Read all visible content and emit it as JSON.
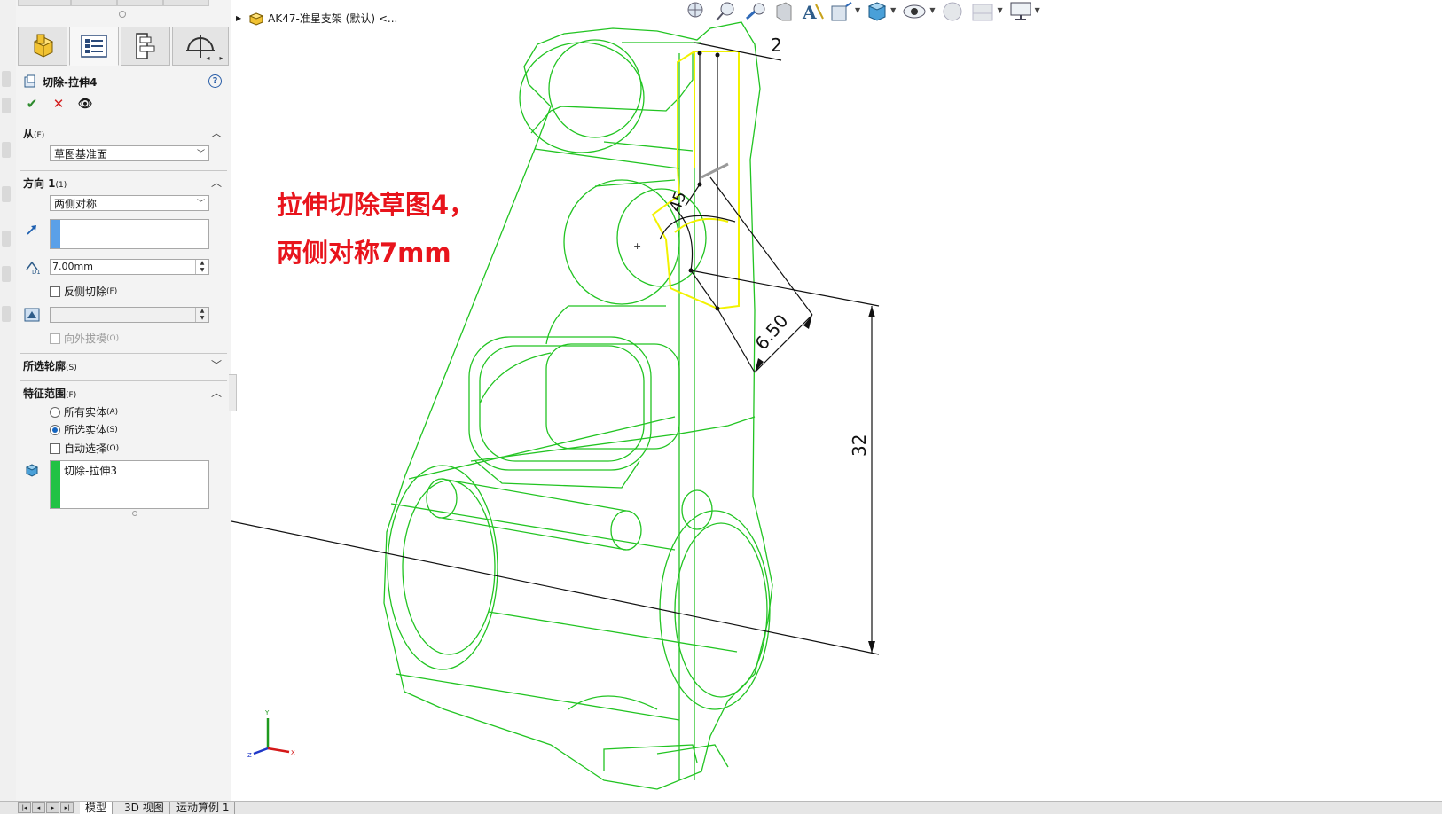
{
  "feature": {
    "title": "切除-拉伸4",
    "help": "?",
    "ok": "✔",
    "cancel": "✕",
    "preview": "👁"
  },
  "sections": {
    "from": {
      "label": "从",
      "hotkey": "(F)",
      "value": "草图基准面"
    },
    "direction1": {
      "label": "方向 1",
      "hotkey": "(1)",
      "end_condition": "两侧对称",
      "depth": "7.00mm",
      "flip_side": "反侧切除",
      "flip_hotkey": "(F)",
      "draft_outward": "向外拔模",
      "draft_hotkey": "(O)"
    },
    "selected_contours": {
      "label": "所选轮廓",
      "hotkey": "(S)"
    },
    "feature_scope": {
      "label": "特征范围",
      "hotkey": "(F)",
      "options": [
        {
          "label": "所有实体",
          "hotkey": "(A)",
          "selected": false
        },
        {
          "label": "所选实体",
          "hotkey": "(S)",
          "selected": true
        }
      ],
      "auto_select": "自动选择",
      "auto_hotkey": "(O)",
      "bodies": [
        "切除-拉伸3"
      ]
    }
  },
  "tree": {
    "root": "AK47-准星支架 (默认) <..."
  },
  "annotation": {
    "line1": "拉伸切除草图4，",
    "line2": "两侧对称7mm"
  },
  "dimensions": {
    "top": "2",
    "angle": "45",
    "width": "6.50",
    "height": "32"
  },
  "triad": {
    "x": "X",
    "y": "Y",
    "z": "Z"
  },
  "bottom_tabs": [
    "模型",
    "3D 视图",
    "运动算例 1"
  ],
  "colors": {
    "model_edges": "#22c422",
    "highlight": "#f2f200",
    "annotation": "#e8141c",
    "accent": "#1565c0"
  },
  "hud_icons": [
    "zoom-to-fit-icon",
    "zoom-area-icon",
    "previous-view-icon",
    "section-view-icon",
    "dynamic-annotation-icon",
    "view-orientation-icon",
    "display-style-icon",
    "hide-show-icon",
    "appearance-icon",
    "scene-icon",
    "view-settings-icon"
  ]
}
